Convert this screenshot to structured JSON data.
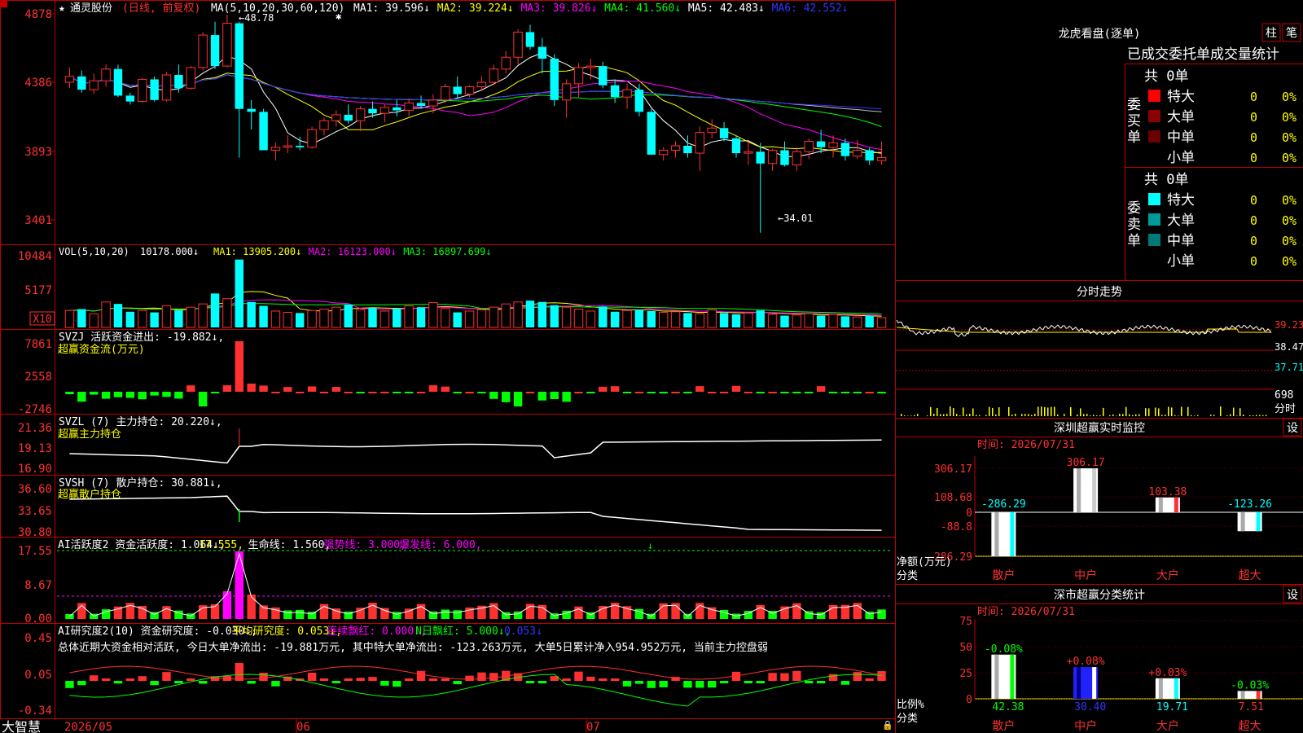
{
  "app": {
    "brand": "大智慧"
  },
  "stock": {
    "name": "通灵股份",
    "mode": "(日线, 前复权)"
  },
  "main": {
    "yticks": [
      "4878",
      "4386",
      "3893",
      "3401"
    ],
    "ma_label": "MA(5,10,20,30,60,120)",
    "ma": [
      {
        "label": "MA1: 39.596↓",
        "color": "#ffffff"
      },
      {
        "label": "MA2: 39.224↓",
        "color": "#ffff00"
      },
      {
        "label": "MA3: 39.826↓",
        "color": "#ff00ff"
      },
      {
        "label": "MA4: 41.560↓",
        "color": "#00ff00"
      },
      {
        "label": "MA5: 42.483↓",
        "color": "#ffffff"
      },
      {
        "label": "MA6: 42.552↓",
        "color": "#3333ff"
      }
    ],
    "high_label": "48.78",
    "low_label": "34.01"
  },
  "vol": {
    "label": "VOL(5,10,20)",
    "value": "10178.000↓",
    "ma": [
      {
        "label": "MA1: 13905.200↓",
        "color": "#ffff00"
      },
      {
        "label": "MA2: 16123.000↓",
        "color": "#ff00ff"
      },
      {
        "label": "MA3: 16897.699↓",
        "color": "#00ff00"
      }
    ],
    "yticks": [
      "10484",
      "5177"
    ],
    "unit": "X10"
  },
  "svzj": {
    "label": "SVZJ  活跃资金进出: -19.882↓,",
    "sub": "超赢资金流(万元)",
    "yticks": [
      "7861",
      "2558",
      "-2746"
    ]
  },
  "svzl": {
    "label": "SVZL (7) 主力持仓: 20.220↓,",
    "sub": "超赢主力持仓",
    "yticks": [
      "21.36",
      "19.13",
      "16.90"
    ]
  },
  "svsh": {
    "label": "SVSH (7) 散户持仓: 30.881↓,",
    "sub": "超赢散户持仓",
    "yticks": [
      "36.60",
      "33.65",
      "30.80"
    ]
  },
  "ai1": {
    "parts": [
      {
        "text": "AI活跃度2 资金活跃度: 1.064↓,",
        "color": "#ffffff"
      },
      {
        "text": "17.555,",
        "color": "#ffff00"
      },
      {
        "text": "生命线: 1.560,",
        "color": "#ffffff"
      },
      {
        "text": "强势线: 3.000,",
        "color": "#ff00ff"
      },
      {
        "text": "爆发线: 6.000,",
        "color": "#ff00ff"
      }
    ],
    "yticks": [
      "17.55",
      "8.67",
      "0.00"
    ]
  },
  "ai2": {
    "parts": [
      {
        "text": "AI研究度2(10) 资金研究度: -0.030↓,",
        "color": "#ffffff"
      },
      {
        "text": "平均研究度: 0.053↓,",
        "color": "#ffff00"
      },
      {
        "text": "连续飘红: 0.000↓,",
        "color": "#ff00ff"
      },
      {
        "text": "N日飘红: 5.000↓,",
        "color": "#00ff00"
      },
      {
        "text": "0.053↓",
        "color": "#3333ff"
      }
    ],
    "summary": "总体近期大资金相对活跃, 今日大单净流出: -19.881万元, 其中特大单净流出: -123.263万元, 大单5日累计净入954.952万元, 当前主力控盘弱",
    "yticks": [
      "0.45",
      "0.05",
      "-0.34"
    ]
  },
  "xaxis": [
    "2026/05",
    "06",
    "07"
  ],
  "right": {
    "lhb": {
      "title": "龙虎看盘(逐单)",
      "btn1": "柱",
      "btn2": "笔",
      "header": "已成交委托单成交量统计",
      "buy": {
        "side": "委买单",
        "total": "共 0单",
        "rows": [
          {
            "name": "特大",
            "vol": "0",
            "pct": "0%",
            "color": "#ff0000"
          },
          {
            "name": "大单",
            "vol": "0",
            "pct": "0%",
            "color": "#8b0000"
          },
          {
            "name": "中单",
            "vol": "0",
            "pct": "0%",
            "color": "#6b0000"
          },
          {
            "name": "小单",
            "vol": "0",
            "pct": "0%",
            "color": ""
          }
        ]
      },
      "sell": {
        "side": "委卖单",
        "total": "共 0单",
        "rows": [
          {
            "name": "特大",
            "vol": "0",
            "pct": "0%",
            "color": "#00ffff"
          },
          {
            "name": "大单",
            "vol": "0",
            "pct": "0%",
            "color": "#009a9a"
          },
          {
            "name": "中单",
            "vol": "0",
            "pct": "0%",
            "color": "#007878"
          },
          {
            "name": "小单",
            "vol": "0",
            "pct": "0%",
            "color": ""
          }
        ]
      }
    },
    "fenshi": {
      "title": "分时走势",
      "yticks": [
        "39.23",
        "38.47",
        "37.71"
      ],
      "vol_label": "698",
      "vol_unit": "分时"
    },
    "monitor": {
      "title": "深圳超赢实时监控",
      "btn": "设",
      "time": "时间: 2026/07/31",
      "yticks": [
        "306.17",
        "108.68",
        "0",
        "-88.8",
        "-286.29"
      ],
      "bars": [
        {
          "cat": "散户",
          "value": -286.29,
          "label": "-286.29"
        },
        {
          "cat": "中户",
          "value": 306.17,
          "label": "306.17"
        },
        {
          "cat": "大户",
          "value": 103.38,
          "label": "103.38"
        },
        {
          "cat": "超大",
          "value": -123.26,
          "label": "-123.26"
        }
      ],
      "y_title": "净额(万元)",
      "x_title": "分类"
    },
    "classify": {
      "title": "深市超赢分类统计",
      "btn": "设",
      "time": "时间: 2026/07/31",
      "yticks": [
        "75",
        "50",
        "25",
        "0"
      ],
      "bars": [
        {
          "cat": "散户",
          "value": 42.38,
          "label": "42.38",
          "delta": "-0.08%"
        },
        {
          "cat": "中户",
          "value": 30.4,
          "label": "30.40",
          "delta": "+0.08%"
        },
        {
          "cat": "大户",
          "value": 19.71,
          "label": "19.71",
          "delta": "+0.03%"
        },
        {
          "cat": "超大",
          "value": 7.51,
          "label": "7.51",
          "delta": "-0.03%"
        }
      ],
      "y_title": "比例%",
      "x_title": "分类"
    }
  },
  "chart_data": [
    {
      "type": "candlestick",
      "title": "通灵股份 (日线, 前复权)",
      "x": [
        "2026/05",
        "06",
        "07"
      ],
      "ohlc": [
        [
          44.2,
          45.2,
          43.8,
          44.6
        ],
        [
          44.6,
          45.0,
          43.5,
          43.7
        ],
        [
          43.7,
          44.8,
          43.4,
          44.3
        ],
        [
          44.3,
          45.4,
          43.9,
          45.1
        ],
        [
          45.1,
          45.4,
          43.2,
          43.3
        ],
        [
          43.3,
          43.5,
          42.7,
          42.9
        ],
        [
          42.9,
          44.5,
          42.8,
          44.4
        ],
        [
          44.4,
          44.6,
          42.9,
          43.0
        ],
        [
          43.0,
          44.9,
          42.9,
          44.7
        ],
        [
          44.7,
          45.4,
          43.5,
          43.8
        ],
        [
          43.8,
          45.3,
          43.7,
          45.2
        ],
        [
          45.2,
          47.6,
          45.0,
          47.4
        ],
        [
          47.4,
          48.3,
          45.1,
          45.3
        ],
        [
          45.3,
          48.78,
          45.2,
          48.2
        ],
        [
          48.2,
          48.3,
          39.1,
          42.4
        ],
        [
          42.4,
          43.0,
          41.0,
          42.2
        ],
        [
          42.2,
          42.4,
          39.6,
          39.6
        ],
        [
          39.6,
          40.1,
          38.9,
          39.8
        ],
        [
          39.8,
          40.6,
          39.4,
          39.9
        ],
        [
          39.9,
          40.5,
          39.6,
          39.8
        ],
        [
          39.8,
          41.2,
          39.7,
          41.0
        ],
        [
          41.0,
          41.8,
          40.6,
          41.6
        ],
        [
          41.6,
          42.3,
          41.2,
          42.0
        ],
        [
          42.0,
          42.7,
          41.4,
          41.6
        ],
        [
          41.6,
          42.6,
          40.9,
          42.4
        ],
        [
          42.4,
          42.9,
          41.8,
          42.1
        ],
        [
          42.1,
          42.7,
          41.5,
          42.5
        ],
        [
          42.5,
          43.0,
          41.9,
          42.3
        ],
        [
          42.3,
          43.1,
          41.9,
          42.8
        ],
        [
          42.8,
          43.3,
          42.4,
          42.6
        ],
        [
          42.6,
          43.4,
          42.1,
          43.0
        ],
        [
          43.0,
          44.1,
          42.8,
          43.9
        ],
        [
          43.9,
          44.6,
          43.1,
          43.4
        ],
        [
          43.4,
          44.0,
          43.2,
          43.9
        ],
        [
          43.9,
          44.6,
          43.6,
          44.2
        ],
        [
          44.2,
          45.4,
          44.0,
          45.1
        ],
        [
          45.1,
          46.3,
          44.8,
          45.9
        ],
        [
          45.9,
          47.8,
          45.4,
          47.6
        ],
        [
          47.6,
          48.1,
          46.4,
          46.6
        ],
        [
          46.6,
          47.2,
          44.8,
          45.8
        ],
        [
          45.8,
          46.1,
          42.6,
          43.0
        ],
        [
          43.0,
          44.4,
          41.8,
          44.1
        ],
        [
          44.1,
          45.5,
          43.2,
          45.2
        ],
        [
          45.2,
          45.8,
          44.4,
          45.3
        ],
        [
          45.3,
          45.6,
          43.8,
          44.0
        ],
        [
          44.0,
          44.4,
          42.8,
          43.2
        ],
        [
          43.2,
          44.1,
          42.4,
          43.7
        ],
        [
          43.7,
          44.1,
          41.9,
          42.2
        ],
        [
          42.2,
          42.4,
          39.4,
          39.3
        ],
        [
          39.3,
          39.8,
          38.9,
          39.6
        ],
        [
          39.6,
          40.2,
          39.1,
          39.9
        ],
        [
          39.9,
          40.6,
          39.1,
          39.4
        ],
        [
          39.4,
          41.2,
          38.2,
          40.8
        ],
        [
          40.8,
          41.7,
          40.4,
          41.1
        ],
        [
          41.1,
          41.5,
          40.2,
          40.4
        ],
        [
          40.4,
          40.6,
          39.1,
          39.4
        ],
        [
          39.4,
          40.2,
          38.6,
          39.5
        ],
        [
          39.5,
          40.1,
          34.01,
          38.7
        ],
        [
          38.7,
          39.7,
          38.2,
          39.6
        ],
        [
          39.6,
          40.2,
          38.5,
          38.6
        ],
        [
          38.6,
          39.8,
          38.2,
          39.5
        ],
        [
          39.5,
          40.4,
          39.0,
          40.2
        ],
        [
          40.2,
          41.0,
          39.4,
          39.8
        ],
        [
          39.8,
          40.6,
          39.1,
          40.1
        ],
        [
          40.1,
          40.4,
          38.9,
          39.2
        ],
        [
          39.2,
          40.3,
          39.0,
          39.6
        ],
        [
          39.6,
          39.8,
          38.6,
          38.9
        ],
        [
          38.9,
          40.2,
          38.6,
          39.1
        ]
      ],
      "ylim": [
        33.5,
        49.5
      ]
    },
    {
      "type": "bar",
      "title": "VOL(5,10,20)",
      "values": [
        2.6,
        2.8,
        2.1,
        3.9,
        3.6,
        2.4,
        2.6,
        2.3,
        3.3,
        2.6,
        3.1,
        3.6,
        5.2,
        4.4,
        10.4,
        3.9,
        3.3,
        2.5,
        2.3,
        2.2,
        2.6,
        2.8,
        3.1,
        3.5,
        2.7,
        3.0,
        2.5,
        2.9,
        3.3,
        3.1,
        3.8,
        2.9,
        2.3,
        2.5,
        2.7,
        3.1,
        3.6,
        3.9,
        4.1,
        3.9,
        3.4,
        3.1,
        2.8,
        2.5,
        3.2,
        2.4,
        2.6,
        2.7,
        2.5,
        2.3,
        2.4,
        2.2,
        2.1,
        2.7,
        2.2,
        2.0,
        2.2,
        2.6,
        2.0,
        1.8,
        1.9,
        2.1,
        1.8,
        2.0,
        1.7,
        1.6,
        1.8,
        1.5
      ],
      "ylim": [
        0,
        10.484
      ]
    }
  ]
}
